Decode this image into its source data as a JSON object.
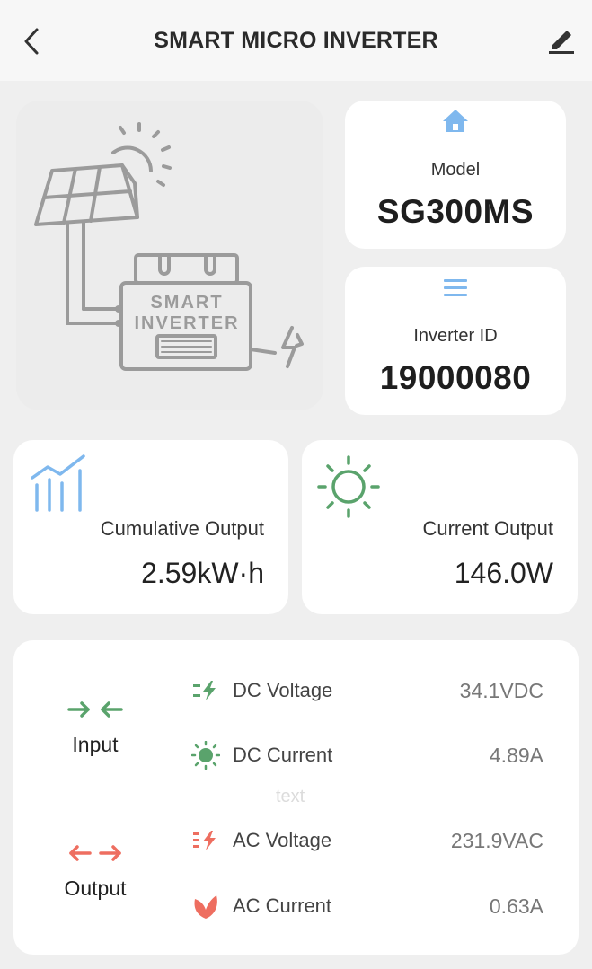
{
  "header": {
    "title": "SMART MICRO INVERTER",
    "back_icon": "chevron-left-icon",
    "edit_icon": "pencil-icon"
  },
  "illustration": {
    "label_line1": "SMART",
    "label_line2": "INVERTER"
  },
  "model": {
    "icon": "home-icon",
    "label": "Model",
    "value": "SG300MS"
  },
  "inverter_id": {
    "icon": "menu-lines-icon",
    "label": "Inverter ID",
    "value": "19000080"
  },
  "cumulative": {
    "icon": "chart-icon",
    "label": "Cumulative Output",
    "value": "2.59kW·h"
  },
  "current": {
    "icon": "sun-icon",
    "label": "Current Output",
    "value": "146.0W"
  },
  "params": {
    "input_label": "Input",
    "output_label": "Output",
    "ghost_text": "text",
    "rows": [
      {
        "name": "DC Voltage",
        "value": "34.1VDC"
      },
      {
        "name": "DC Current",
        "value": "4.89A"
      },
      {
        "name": "AC Voltage",
        "value": "231.9VAC"
      },
      {
        "name": "AC Current",
        "value": "0.63A"
      }
    ]
  },
  "colors": {
    "blue": "#7fb8ee",
    "green": "#5aa36c",
    "red": "#ee6e60",
    "gray_line": "#9b9b9b"
  }
}
